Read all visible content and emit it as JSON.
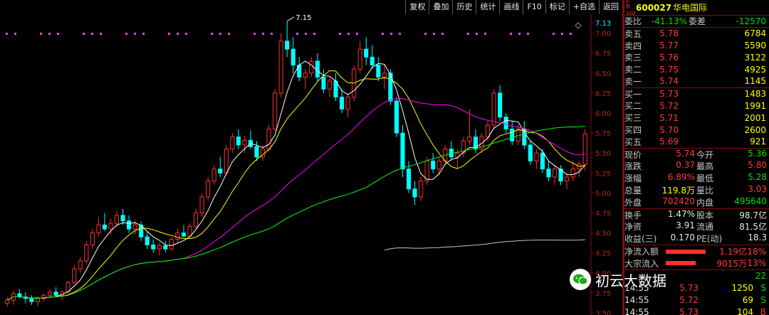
{
  "toolbar": {
    "buttons": [
      "复权",
      "叠加",
      "历史",
      "统计",
      "画线",
      "F10",
      "标记",
      "+自选",
      "返回"
    ]
  },
  "chart": {
    "yticks": [
      "7.13",
      "7.00",
      "6.75",
      "6.50",
      "6.25",
      "6.00",
      "5.75",
      "5.50",
      "5.25",
      "5.00",
      "4.75",
      "4.50",
      "4.25",
      "4.00",
      "3.75",
      "3.50"
    ],
    "high_label": "7.15",
    "colors": {
      "up": "#ff3030",
      "down": "#00ffff",
      "ma5": "#ffffff",
      "ma10": "#ffff00",
      "ma30": "#ff00ff",
      "ma60": "#00ff00",
      "ma120": "#d0c0c0"
    }
  },
  "chart_data": {
    "type": "candlestick",
    "ylim": [
      3.5,
      7.13
    ],
    "ohlc": [
      [
        3.62,
        3.7,
        3.58,
        3.66
      ],
      [
        3.66,
        3.78,
        3.6,
        3.74
      ],
      [
        3.74,
        3.8,
        3.68,
        3.7
      ],
      [
        3.7,
        3.76,
        3.62,
        3.68
      ],
      [
        3.68,
        3.72,
        3.6,
        3.64
      ],
      [
        3.64,
        3.7,
        3.58,
        3.68
      ],
      [
        3.68,
        3.74,
        3.64,
        3.72
      ],
      [
        3.72,
        3.8,
        3.68,
        3.76
      ],
      [
        3.76,
        3.82,
        3.7,
        3.72
      ],
      [
        3.72,
        3.78,
        3.66,
        3.76
      ],
      [
        3.76,
        3.9,
        3.74,
        3.88
      ],
      [
        3.88,
        4.1,
        3.86,
        4.05
      ],
      [
        4.05,
        4.2,
        4.0,
        4.15
      ],
      [
        4.15,
        4.4,
        4.12,
        4.35
      ],
      [
        4.35,
        4.55,
        4.3,
        4.5
      ],
      [
        4.5,
        4.7,
        4.45,
        4.6
      ],
      [
        4.6,
        4.75,
        4.52,
        4.55
      ],
      [
        4.55,
        4.68,
        4.48,
        4.62
      ],
      [
        4.62,
        4.78,
        4.58,
        4.72
      ],
      [
        4.72,
        4.8,
        4.6,
        4.65
      ],
      [
        4.65,
        4.72,
        4.5,
        4.55
      ],
      [
        4.55,
        4.66,
        4.48,
        4.6
      ],
      [
        4.6,
        4.64,
        4.4,
        4.45
      ],
      [
        4.45,
        4.52,
        4.3,
        4.35
      ],
      [
        4.35,
        4.42,
        4.25,
        4.3
      ],
      [
        4.3,
        4.38,
        4.22,
        4.34
      ],
      [
        4.34,
        4.4,
        4.26,
        4.3
      ],
      [
        4.3,
        4.45,
        4.28,
        4.42
      ],
      [
        4.42,
        4.55,
        4.38,
        4.5
      ],
      [
        4.5,
        4.6,
        4.44,
        4.46
      ],
      [
        4.46,
        4.62,
        4.44,
        4.58
      ],
      [
        4.58,
        4.8,
        4.55,
        4.75
      ],
      [
        4.75,
        5.0,
        4.7,
        4.95
      ],
      [
        4.95,
        5.2,
        4.9,
        5.15
      ],
      [
        5.15,
        5.35,
        5.1,
        5.3
      ],
      [
        5.3,
        5.45,
        5.2,
        5.25
      ],
      [
        5.25,
        5.6,
        5.22,
        5.55
      ],
      [
        5.55,
        5.75,
        5.5,
        5.7
      ],
      [
        5.7,
        5.8,
        5.55,
        5.6
      ],
      [
        5.6,
        5.72,
        5.5,
        5.66
      ],
      [
        5.66,
        5.78,
        5.55,
        5.58
      ],
      [
        5.58,
        5.65,
        5.4,
        5.45
      ],
      [
        5.45,
        5.6,
        5.4,
        5.55
      ],
      [
        5.55,
        5.85,
        5.52,
        5.8
      ],
      [
        5.8,
        6.3,
        5.78,
        6.25
      ],
      [
        6.25,
        7.0,
        6.2,
        6.9
      ],
      [
        6.9,
        7.15,
        6.7,
        6.8
      ],
      [
        6.8,
        6.95,
        6.5,
        6.6
      ],
      [
        6.6,
        6.7,
        6.4,
        6.45
      ],
      [
        6.45,
        6.55,
        6.3,
        6.5
      ],
      [
        6.5,
        6.7,
        6.45,
        6.65
      ],
      [
        6.65,
        6.75,
        6.4,
        6.45
      ],
      [
        6.45,
        6.55,
        6.25,
        6.3
      ],
      [
        6.3,
        6.45,
        6.2,
        6.4
      ],
      [
        6.4,
        6.5,
        6.15,
        6.2
      ],
      [
        6.2,
        6.3,
        6.0,
        6.05
      ],
      [
        6.05,
        6.25,
        5.95,
        6.2
      ],
      [
        6.2,
        6.6,
        6.15,
        6.55
      ],
      [
        6.55,
        6.9,
        6.5,
        6.8
      ],
      [
        6.8,
        6.95,
        6.6,
        6.7
      ],
      [
        6.7,
        6.85,
        6.55,
        6.6
      ],
      [
        6.6,
        6.7,
        6.4,
        6.45
      ],
      [
        6.45,
        6.6,
        6.3,
        6.5
      ],
      [
        6.5,
        6.55,
        6.1,
        6.15
      ],
      [
        6.15,
        6.2,
        5.7,
        5.75
      ],
      [
        5.75,
        5.85,
        5.2,
        5.3
      ],
      [
        5.3,
        5.4,
        5.0,
        5.05
      ],
      [
        5.05,
        5.15,
        4.85,
        4.95
      ],
      [
        4.95,
        5.2,
        4.9,
        5.15
      ],
      [
        5.15,
        5.45,
        5.1,
        5.4
      ],
      [
        5.4,
        5.5,
        5.25,
        5.3
      ],
      [
        5.3,
        5.45,
        5.22,
        5.4
      ],
      [
        5.4,
        5.6,
        5.35,
        5.55
      ],
      [
        5.55,
        5.65,
        5.4,
        5.45
      ],
      [
        5.45,
        5.55,
        5.3,
        5.5
      ],
      [
        5.5,
        5.7,
        5.45,
        5.65
      ],
      [
        5.65,
        6.05,
        5.6,
        5.7
      ],
      [
        5.7,
        5.8,
        5.5,
        5.55
      ],
      [
        5.55,
        5.75,
        5.5,
        5.7
      ],
      [
        5.7,
        5.9,
        5.65,
        5.85
      ],
      [
        5.85,
        6.3,
        5.8,
        6.25
      ],
      [
        6.25,
        6.35,
        5.9,
        5.95
      ],
      [
        5.95,
        6.0,
        5.75,
        5.8
      ],
      [
        5.8,
        5.9,
        5.6,
        5.65
      ],
      [
        5.65,
        5.85,
        5.6,
        5.8
      ],
      [
        5.8,
        5.9,
        5.55,
        5.6
      ],
      [
        5.6,
        5.65,
        5.35,
        5.4
      ],
      [
        5.4,
        5.55,
        5.3,
        5.5
      ],
      [
        5.5,
        5.55,
        5.25,
        5.3
      ],
      [
        5.3,
        5.4,
        5.15,
        5.2
      ],
      [
        5.2,
        5.35,
        5.1,
        5.3
      ],
      [
        5.3,
        5.35,
        5.1,
        5.15
      ],
      [
        5.15,
        5.25,
        5.05,
        5.2
      ],
      [
        5.2,
        5.4,
        5.15,
        5.3
      ],
      [
        5.3,
        5.4,
        5.2,
        5.36
      ],
      [
        5.36,
        5.8,
        5.28,
        5.74
      ]
    ]
  },
  "quote": {
    "header": {
      "lr_top": "L R",
      "lr_bot": "500",
      "code": "600027",
      "name": "华电国际"
    },
    "weibi": {
      "label": "委比",
      "value": "-41.13%",
      "label2": "委差",
      "value2": "-12570"
    },
    "asks": [
      {
        "label": "卖五",
        "price": "5.78",
        "vol": "6784"
      },
      {
        "label": "卖四",
        "price": "5.77",
        "vol": "5590"
      },
      {
        "label": "卖三",
        "price": "5.76",
        "vol": "3122"
      },
      {
        "label": "卖二",
        "price": "5.75",
        "vol": "4925"
      },
      {
        "label": "卖一",
        "price": "5.74",
        "vol": "1145"
      }
    ],
    "bids": [
      {
        "label": "买一",
        "price": "5.73",
        "vol": "1483"
      },
      {
        "label": "买二",
        "price": "5.72",
        "vol": "1991"
      },
      {
        "label": "买三",
        "price": "5.71",
        "vol": "2001"
      },
      {
        "label": "买四",
        "price": "5.70",
        "vol": "2600"
      },
      {
        "label": "买五",
        "price": "5.69",
        "vol": "921"
      }
    ],
    "stats": [
      {
        "k1": "现价",
        "v1": "5.74",
        "c1": "red",
        "k2": "今开",
        "v2": "5.36",
        "c2": "green"
      },
      {
        "k1": "涨跌",
        "v1": "0.37",
        "c1": "red",
        "k2": "最高",
        "v2": "5.80",
        "c2": "red"
      },
      {
        "k1": "涨幅",
        "v1": "6.89%",
        "c1": "red",
        "k2": "最低",
        "v2": "5.28",
        "c2": "green"
      },
      {
        "k1": "总量",
        "v1": "119.8万",
        "c1": "yellow",
        "k2": "量比",
        "v2": "3.03",
        "c2": "red"
      },
      {
        "k1": "外盘",
        "v1": "702420",
        "c1": "red",
        "k2": "内盘",
        "v2": "495640",
        "c2": "green"
      }
    ],
    "fund": [
      {
        "k1": "换手",
        "v1": "1.47%",
        "k2": "股本",
        "v2": "98.7亿"
      },
      {
        "k1": "净资",
        "v1": "3.91",
        "k2": "流通",
        "v2": "81.5亿"
      },
      {
        "k1": "收益(三)",
        "v1": "0.170",
        "k2": "PE(动)",
        "v2": "18.3"
      }
    ],
    "flows": [
      {
        "label": "净流入额",
        "value": "1.19亿",
        "pct": "18%",
        "bar": 0.8
      },
      {
        "label": "大宗流入",
        "value": "9015万",
        "pct": "13%",
        "bar": 0.6
      }
    ],
    "ticks": [
      {
        "time": "14:55",
        "price": "5.73",
        "vol": "1250",
        "side": "S"
      },
      {
        "time": "14:55",
        "price": "5.72",
        "vol": "69",
        "side": "S"
      },
      {
        "time": "14:55",
        "price": "5.73",
        "vol": "104",
        "side": "B"
      }
    ],
    "tick_first_side": "22"
  },
  "watermark": {
    "text": "初云大数据"
  }
}
